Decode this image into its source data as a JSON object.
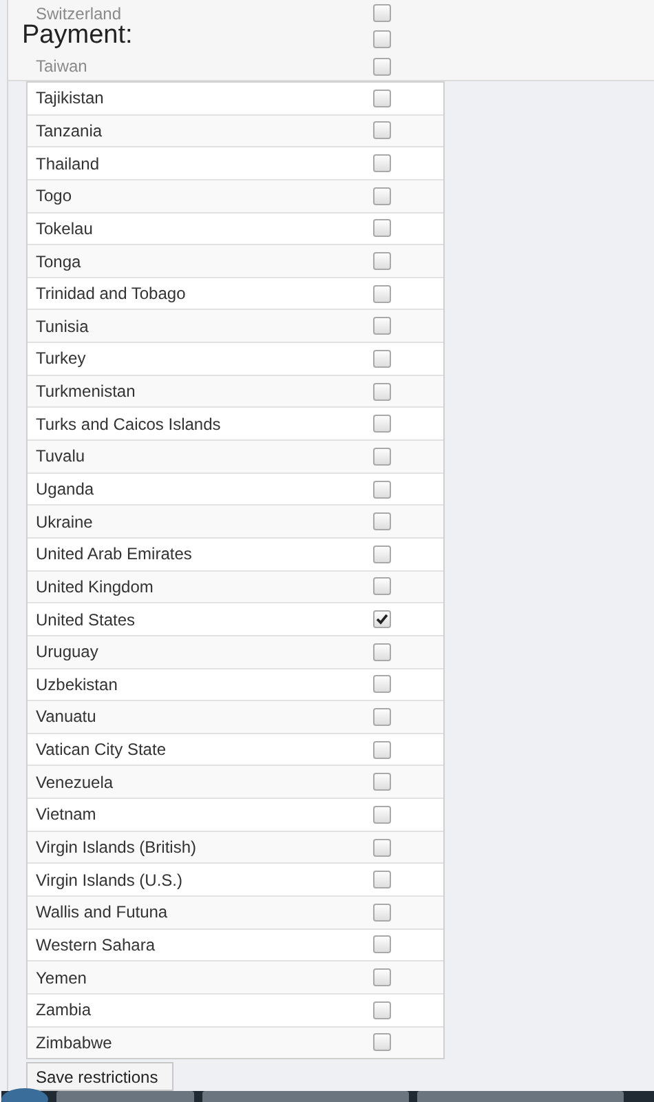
{
  "section_title": "Payment:",
  "faded_rows": [
    {
      "name": "Switzerland",
      "checked": false
    },
    {
      "checked": false
    },
    {
      "name": "Taiwan",
      "checked": false
    }
  ],
  "countries": [
    {
      "name": "Tajikistan",
      "checked": false
    },
    {
      "name": "Tanzania",
      "checked": false
    },
    {
      "name": "Thailand",
      "checked": false
    },
    {
      "name": "Togo",
      "checked": false
    },
    {
      "name": "Tokelau",
      "checked": false
    },
    {
      "name": "Tonga",
      "checked": false
    },
    {
      "name": "Trinidad and Tobago",
      "checked": false
    },
    {
      "name": "Tunisia",
      "checked": false
    },
    {
      "name": "Turkey",
      "checked": false
    },
    {
      "name": "Turkmenistan",
      "checked": false
    },
    {
      "name": "Turks and Caicos Islands",
      "checked": false
    },
    {
      "name": "Tuvalu",
      "checked": false
    },
    {
      "name": "Uganda",
      "checked": false
    },
    {
      "name": "Ukraine",
      "checked": false
    },
    {
      "name": "United Arab Emirates",
      "checked": false
    },
    {
      "name": "United Kingdom",
      "checked": false
    },
    {
      "name": "United States",
      "checked": true
    },
    {
      "name": "Uruguay",
      "checked": false
    },
    {
      "name": "Uzbekistan",
      "checked": false
    },
    {
      "name": "Vanuatu",
      "checked": false
    },
    {
      "name": "Vatican City State",
      "checked": false
    },
    {
      "name": "Venezuela",
      "checked": false
    },
    {
      "name": "Vietnam",
      "checked": false
    },
    {
      "name": "Virgin Islands (British)",
      "checked": false
    },
    {
      "name": "Virgin Islands (U.S.)",
      "checked": false
    },
    {
      "name": "Wallis and Futuna",
      "checked": false
    },
    {
      "name": "Western Sahara",
      "checked": false
    },
    {
      "name": "Yemen",
      "checked": false
    },
    {
      "name": "Zambia",
      "checked": false
    },
    {
      "name": "Zimbabwe",
      "checked": false
    }
  ],
  "save_button": "Save restrictions"
}
